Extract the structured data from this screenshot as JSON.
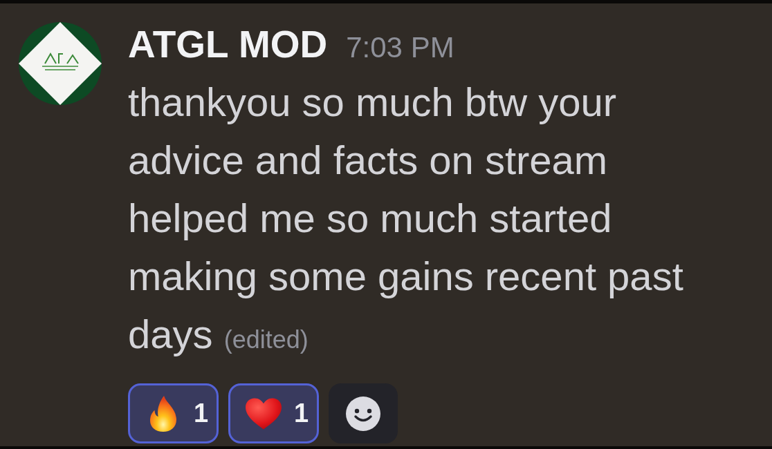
{
  "message": {
    "author": "ATGL MOD",
    "timestamp": "7:03 PM",
    "text": "thankyou so much btw your advice and facts on stream helped me so much started making some gains recent past days",
    "edited_label": "(edited)"
  },
  "reactions": [
    {
      "kind": "fire",
      "count": "1",
      "selected": true
    },
    {
      "kind": "heart",
      "count": "1",
      "selected": true
    }
  ]
}
